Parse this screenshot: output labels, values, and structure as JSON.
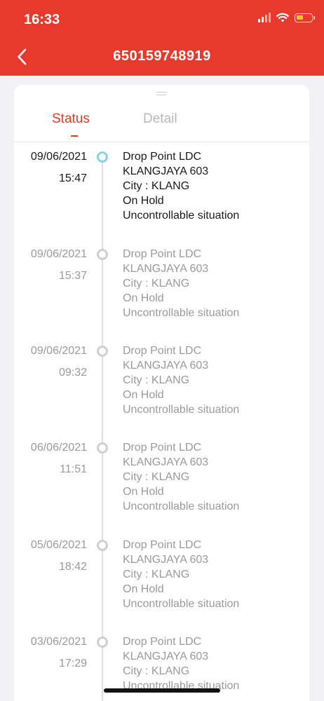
{
  "status_bar": {
    "time": "16:33",
    "battery_color": "#f7c22b"
  },
  "header": {
    "title": "650159748919",
    "back_icon": "chevron-left-icon",
    "bg_color": "#e73a2c"
  },
  "tabs": [
    {
      "label": "Status",
      "active": true
    },
    {
      "label": "Detail",
      "active": false
    }
  ],
  "timeline": [
    {
      "date": "09/06/2021",
      "time": "15:47",
      "lines": [
        "Drop Point LDC",
        "KLANGJAYA 603",
        "City : KLANG",
        "On Hold",
        "Uncontrollable situation"
      ]
    },
    {
      "date": "09/06/2021",
      "time": "15:37",
      "lines": [
        "Drop Point LDC",
        "KLANGJAYA 603",
        "City : KLANG",
        "On Hold",
        "Uncontrollable situation"
      ]
    },
    {
      "date": "09/06/2021",
      "time": "09:32",
      "lines": [
        "Drop Point LDC",
        "KLANGJAYA 603",
        "City : KLANG",
        "On Hold",
        "Uncontrollable situation"
      ]
    },
    {
      "date": "06/06/2021",
      "time": "11:51",
      "lines": [
        "Drop Point LDC",
        "KLANGJAYA 603",
        "City : KLANG",
        "On Hold",
        "Uncontrollable situation"
      ]
    },
    {
      "date": "05/06/2021",
      "time": "18:42",
      "lines": [
        "Drop Point LDC",
        "KLANGJAYA 603",
        "City : KLANG",
        "On Hold",
        "Uncontrollable situation"
      ]
    },
    {
      "date": "03/06/2021",
      "time": "17:29",
      "lines": [
        "Drop Point LDC",
        "KLANGJAYA 603",
        "City : KLANG",
        "Uncontrollable situation"
      ]
    }
  ]
}
